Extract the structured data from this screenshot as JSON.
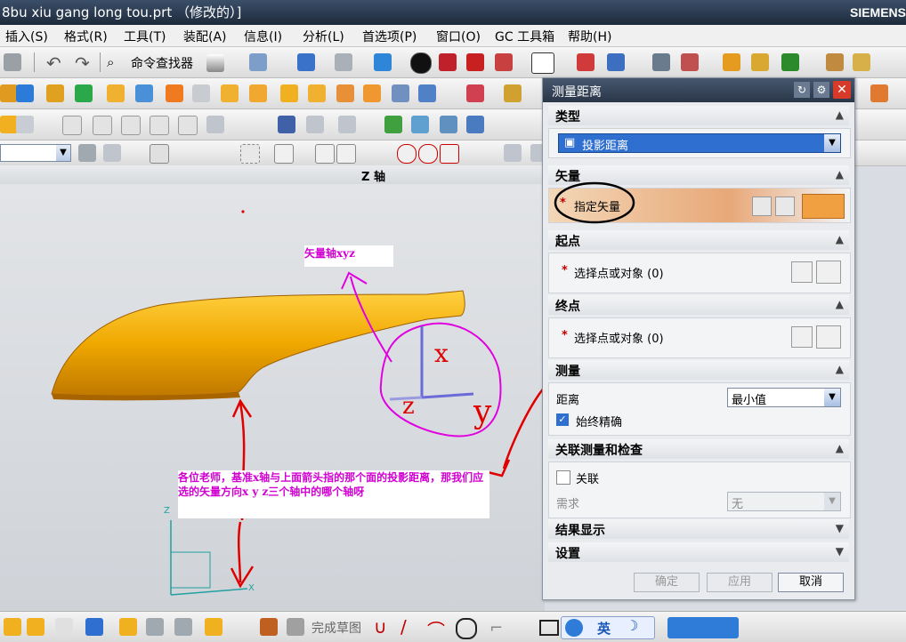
{
  "window": {
    "title": "8bu xiu gang long tou.prt （修改的）]",
    "brand": "SIEMENS"
  },
  "menu": [
    "插入(S)",
    "格式(R)",
    "工具(T)",
    "装配(A)",
    "信息(I)",
    "分析(L)",
    "首选项(P)",
    "窗口(O)",
    "GC 工具箱",
    "帮助(H)"
  ],
  "toolbar": {
    "command_finder": "命令查找器"
  },
  "viewport": {
    "view_label": "Z 轴"
  },
  "triad": {
    "x": "X",
    "y": "Y",
    "z": "Z"
  },
  "annotations": {
    "vector_note": "矢量轴xyz",
    "question": "各位老师，基准x轴与上面箭头指的那个面的投影距离，那我们应选的矢量方向x y z三个轴中的哪个轴呀"
  },
  "dialog": {
    "title": "测量距离",
    "type_section": "类型",
    "type_value": "投影距离",
    "vector_section": "矢量",
    "specify_vector": "指定矢量",
    "start_section": "起点",
    "start_select": "选择点或对象 (0)",
    "end_section": "终点",
    "end_select": "选择点或对象 (0)",
    "measure_section": "测量",
    "distance_label": "距离",
    "distance_value": "最小值",
    "always_accurate": "始终精确",
    "associative_section": "关联测量和检查",
    "associative": "关联",
    "requirement_label": "需求",
    "requirement_value": "无",
    "results_section": "结果显示",
    "settings_section": "设置",
    "ok": "确定",
    "apply": "应用",
    "cancel": "取消"
  },
  "bottom": {
    "finish_sketch": "完成草图",
    "ime": "英"
  },
  "colors": {
    "title_bar": "#2a3648",
    "part": "#f0a800",
    "annotation": "#d000d0",
    "arrow_red": "#e00000"
  }
}
